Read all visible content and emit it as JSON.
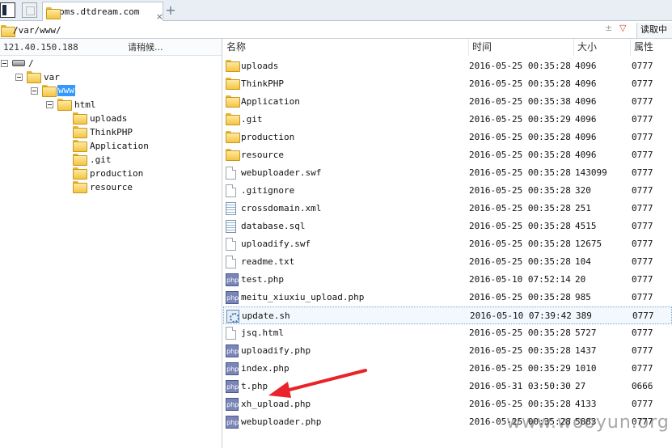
{
  "tabbar": {
    "tab_title": "pms.dtdream.com",
    "close_glyph": "×",
    "add_glyph": "+"
  },
  "pathbar": {
    "path": "/var/www/",
    "tool1": "±",
    "tool2": "▽",
    "read_label": "读取中"
  },
  "left": {
    "ip": "121.40.150.188",
    "status": "请稍候..."
  },
  "tree": {
    "root": "/",
    "var": "var",
    "www": "www",
    "html": "html",
    "children": [
      "uploads",
      "ThinkPHP",
      "Application",
      ".git",
      "production",
      "resource"
    ]
  },
  "columns": {
    "name": "名称",
    "time": "时间",
    "size": "大小",
    "attr": "属性"
  },
  "files": [
    {
      "name": "uploads",
      "time": "2016-05-25 00:35:28",
      "size": "4096",
      "attr": "0777",
      "icon": "folder-icon"
    },
    {
      "name": "ThinkPHP",
      "time": "2016-05-25 00:35:28",
      "size": "4096",
      "attr": "0777",
      "icon": "folder-icon"
    },
    {
      "name": "Application",
      "time": "2016-05-25 00:35:38",
      "size": "4096",
      "attr": "0777",
      "icon": "folder-icon"
    },
    {
      "name": ".git",
      "time": "2016-05-25 00:35:29",
      "size": "4096",
      "attr": "0777",
      "icon": "folder-icon"
    },
    {
      "name": "production",
      "time": "2016-05-25 00:35:28",
      "size": "4096",
      "attr": "0777",
      "icon": "folder-icon"
    },
    {
      "name": "resource",
      "time": "2016-05-25 00:35:28",
      "size": "4096",
      "attr": "0777",
      "icon": "folder-icon"
    },
    {
      "name": "webuploader.swf",
      "time": "2016-05-25 00:35:28",
      "size": "143099",
      "attr": "0777",
      "icon": "file-icon"
    },
    {
      "name": ".gitignore",
      "time": "2016-05-25 00:35:28",
      "size": "320",
      "attr": "0777",
      "icon": "file-icon"
    },
    {
      "name": "crossdomain.xml",
      "time": "2016-05-25 00:35:28",
      "size": "251",
      "attr": "0777",
      "icon": "text-file-icon"
    },
    {
      "name": "database.sql",
      "time": "2016-05-25 00:35:28",
      "size": "4515",
      "attr": "0777",
      "icon": "text-file-icon"
    },
    {
      "name": "uploadify.swf",
      "time": "2016-05-25 00:35:28",
      "size": "12675",
      "attr": "0777",
      "icon": "file-icon"
    },
    {
      "name": "readme.txt",
      "time": "2016-05-25 00:35:28",
      "size": "104",
      "attr": "0777",
      "icon": "file-icon"
    },
    {
      "name": "test.php",
      "time": "2016-05-10 07:52:14",
      "size": "20",
      "attr": "0777",
      "icon": "php-icon"
    },
    {
      "name": "meitu_xiuxiu_upload.php",
      "time": "2016-05-25 00:35:28",
      "size": "985",
      "attr": "0777",
      "icon": "php-icon"
    },
    {
      "name": "update.sh",
      "time": "2016-05-10 07:39:42",
      "size": "389",
      "attr": "0777",
      "icon": "gear-icon"
    },
    {
      "name": "jsq.html",
      "time": "2016-05-25 00:35:28",
      "size": "5727",
      "attr": "0777",
      "icon": "file-icon"
    },
    {
      "name": "uploadify.php",
      "time": "2016-05-25 00:35:28",
      "size": "1437",
      "attr": "0777",
      "icon": "php-icon"
    },
    {
      "name": "index.php",
      "time": "2016-05-25 00:35:29",
      "size": "1010",
      "attr": "0777",
      "icon": "php-icon"
    },
    {
      "name": "t.php",
      "time": "2016-05-31 03:50:30",
      "size": "27",
      "attr": "0666",
      "icon": "php-icon"
    },
    {
      "name": "xh_upload.php",
      "time": "2016-05-25 00:35:28",
      "size": "4133",
      "attr": "0777",
      "icon": "php-icon"
    },
    {
      "name": "webuploader.php",
      "time": "2016-05-25 00:35:28",
      "size": "5883",
      "attr": "0777",
      "icon": "php-icon"
    }
  ],
  "php_glyph": "php",
  "watermark": "www.wooyun.org",
  "colors": {
    "selection": "#3399ff",
    "arrow": "#e8232a"
  }
}
